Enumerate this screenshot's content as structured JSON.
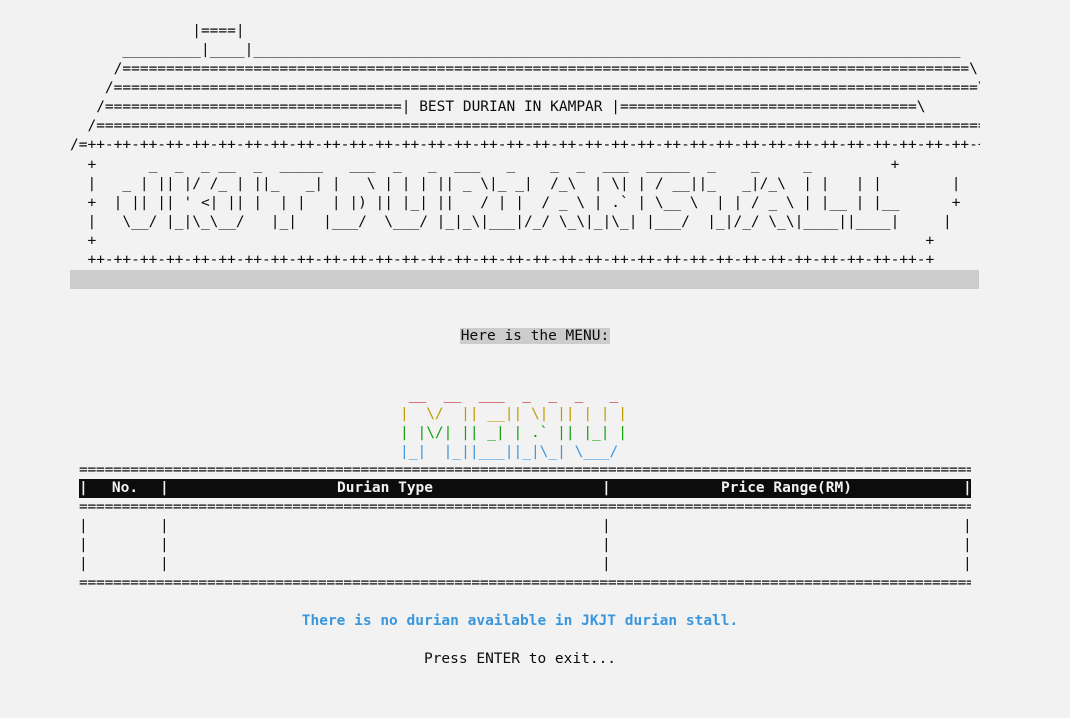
{
  "banner": {
    "roof_lines": [
      "              |====|",
      "      _________|____|_________________________________________________________________________________",
      "     /=================================================================================================\\",
      "    /===================================================================================================\\",
      "   /==================================| BEST DURIAN IN KAMPAR |==================================\\",
      "  /=======================================================================================================\\",
      "/=++-++-++-++-++-++-++-++-++-++-++-++-++-++-++-++-++-++-++-++-++-++-++-++-++-++-++-++-++-++-++-++-++-++-++-+=\\"
    ],
    "sign_lines": [
      "  +      _  _  _ __  _  _____   ___  _   _  ___   _    _  _  ___  _____  _    _     _         +",
      "  |   _ | || |/ /_ | ||_   _| |   \\ | | | || _ \\|_ _|  /_\\  | \\| | / __||_   _|/_\\  | |   | |        |",
      "  +  | || || ' <| || |  | |   | |) || |_| ||   / | |  / _ \\ | .` | \\__ \\  | | / _ \\ | |__ | |__      +",
      "  |   \\__/ |_|\\_\\__/   |_|   |___/  \\___/ |_|_\\|___|/_/ \\_\\|_|\\_| |___/  |_|/_/ \\_\\|____||____|     |",
      "  +                                                                                               +",
      "  ++-++-++-++-++-++-++-++-++-++-++-++-++-++-++-++-++-++-++-++-++-++-++-++-++-++-++-++-++-++-++-++-+"
    ]
  },
  "prompt": "Here is the MENU:",
  "menu_art": [
    " __  __  ___  _  _  _   _ ",
    "|  \\/  || __|| \\| || | | |",
    "| |\\/| || _| | .` || |_| |",
    "|_|  |_||___||_|\\_| \\___/"
  ],
  "table": {
    "rule": "==============================================================================================================",
    "headers": {
      "no": "No.",
      "type": "Durian Type",
      "price": "Price Range(RM)"
    },
    "blank_rows": 3
  },
  "notice": "There is no durian available in JKJT durian stall.",
  "exit_prompt": "Press ENTER to exit...",
  "colors": {
    "background": "#f2f2f2",
    "text": "#0c0c0c",
    "highlight": "#cccccc",
    "menu_red": "#c50f1f",
    "menu_yellow": "#c19c00",
    "menu_green": "#13a10e",
    "menu_blue": "#3a96dd",
    "notice": "#3a96dd"
  }
}
